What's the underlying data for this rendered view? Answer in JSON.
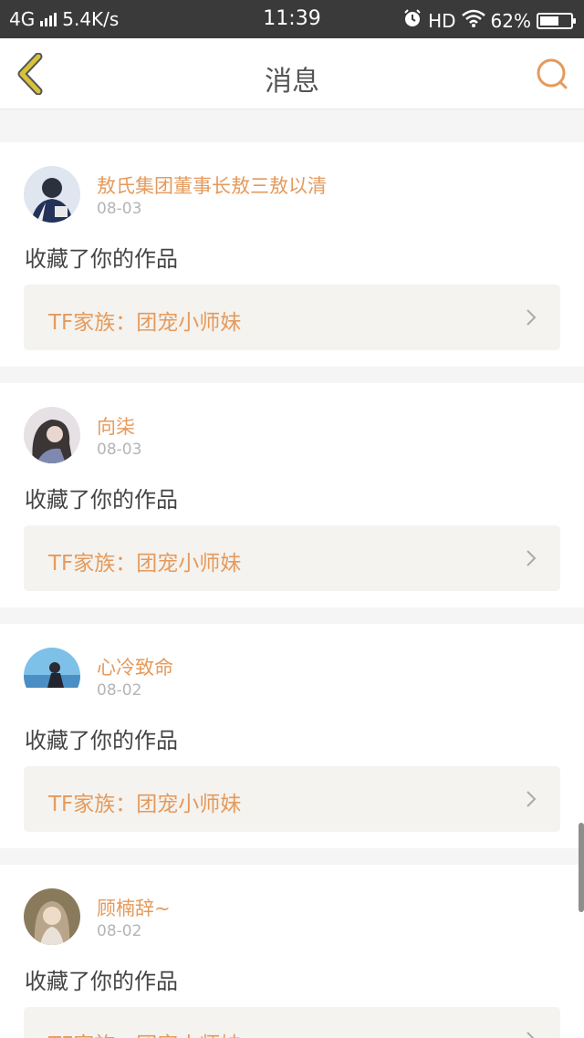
{
  "status_bar": {
    "network": "4G",
    "speed": "5.4K/s",
    "time": "11:39",
    "hd": "HD",
    "battery": "62%",
    "battery_level": 0.62,
    "icons": [
      "signal-icon",
      "alarm-icon",
      "wifi-icon",
      "battery-icon"
    ]
  },
  "nav": {
    "title": "消息",
    "back_icon": "chevron-left-icon",
    "search_icon": "search-icon"
  },
  "colors": {
    "accent": "#e59a5c",
    "back_arrow": "#d8c23a",
    "status_bar": "#3a3a3a"
  },
  "messages": [
    {
      "user": "敖氏集团董事长敖三敖以清",
      "date": "08-03",
      "action": "收藏了你的作品",
      "work": "TF家族：团宠小师妹"
    },
    {
      "user": "向柒",
      "date": "08-03",
      "action": "收藏了你的作品",
      "work": "TF家族：团宠小师妹"
    },
    {
      "user": "心冷致命",
      "date": "08-02",
      "action": "收藏了你的作品",
      "work": "TF家族：团宠小师妹"
    },
    {
      "user": "顾楠辞~",
      "date": "08-02",
      "action": "收藏了你的作品",
      "work": "TF家族：团宠小师妹"
    }
  ]
}
